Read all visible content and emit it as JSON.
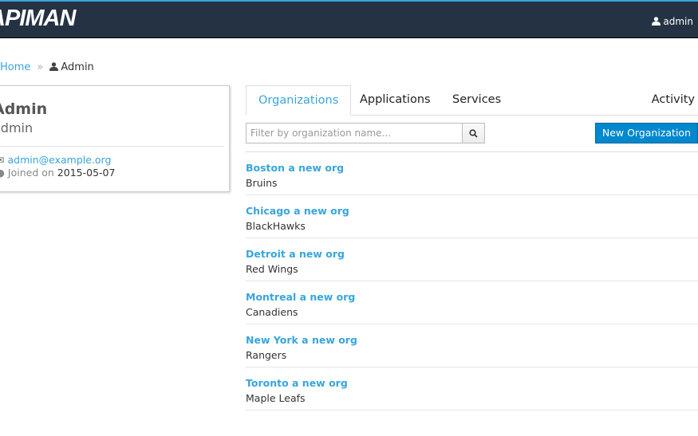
{
  "header": {
    "logo": "APIMAN",
    "user": "admin",
    "accent": "#39a5dc",
    "bg": "#253243"
  },
  "breadcrumb": {
    "home": "Home",
    "separator": "»",
    "current": "Admin"
  },
  "profile": {
    "name": "Admin",
    "username": "admin",
    "email": "admin@example.org",
    "joined_label": "Joined on",
    "joined_date": "2015-05-07"
  },
  "tabs": [
    {
      "label": "Organizations",
      "active": true
    },
    {
      "label": "Applications"
    },
    {
      "label": "Services"
    },
    {
      "label": "Activity"
    }
  ],
  "search": {
    "placeholder": "Filter by organization name...",
    "value": ""
  },
  "new_button": "New Organization",
  "orgs": [
    {
      "name": "Boston a new org",
      "desc": "Bruins"
    },
    {
      "name": "Chicago a new org",
      "desc": "BlackHawks"
    },
    {
      "name": "Detroit a new org",
      "desc": "Red Wings"
    },
    {
      "name": "Montreal a new org",
      "desc": "Canadiens"
    },
    {
      "name": "New York a new org",
      "desc": "Rangers"
    },
    {
      "name": "Toronto a new org",
      "desc": "Maple Leafs"
    }
  ]
}
